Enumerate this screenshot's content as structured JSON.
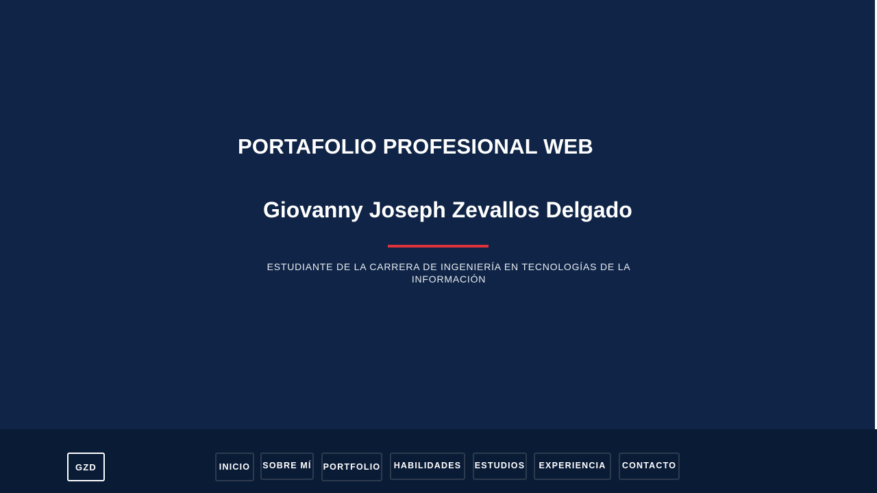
{
  "hero": {
    "title": "PORTAFOLIO PROFESIONAL WEB",
    "name": "Giovanny Joseph Zevallos Delgado",
    "subtitle": "ESTUDIANTE DE LA CARRERA DE INGENIERÍA EN TECNOLOGÍAS DE LA INFORMACIÓN",
    "accent_color": "#e0323c",
    "background_color": "#0f2446"
  },
  "footer": {
    "logo": "GZD",
    "background_color": "#0a1b36",
    "nav": [
      {
        "label": "INICIO"
      },
      {
        "label": "SOBRE MÍ"
      },
      {
        "label": "PORTFOLIO"
      },
      {
        "label": "HABILIDADES"
      },
      {
        "label": "ESTUDIOS"
      },
      {
        "label": "EXPERIENCIA"
      },
      {
        "label": "CONTACTO"
      }
    ]
  }
}
